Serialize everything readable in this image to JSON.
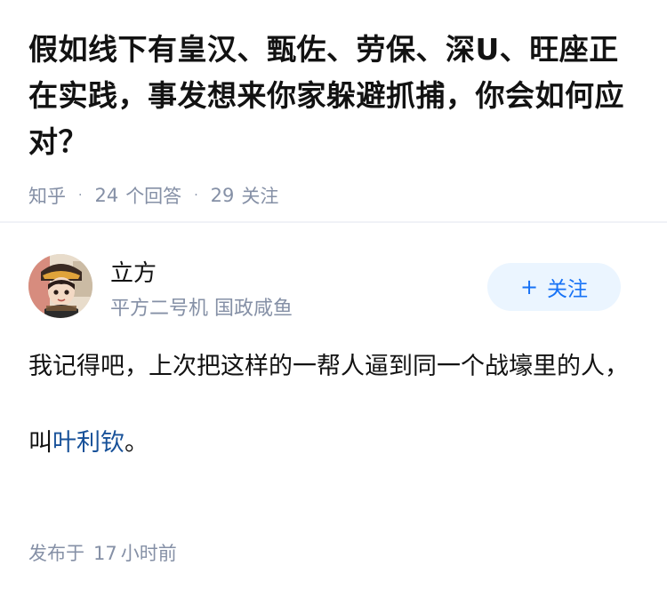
{
  "question": {
    "title": "假如线下有皇汉、甄佐、劳保、深U、旺座正在实践，事发想来你家躲避抓捕，你会如何应对？",
    "source": "知乎",
    "answers_count": "24",
    "answers_label": "个回答",
    "followers_count": "29",
    "followers_label": "关注"
  },
  "answer": {
    "author": {
      "name": "立方",
      "bio": "平方二号机 国政咸鱼",
      "follow_label": "关注",
      "follow_icon": "plus-icon"
    },
    "content": {
      "paragraph1": "我记得吧，上次把这样的一帮人逼到同一个战壕里的人，",
      "paragraph2_prefix": "叫",
      "paragraph2_link": "叶利钦",
      "paragraph2_suffix": "。"
    },
    "time": {
      "prefix": "发布于",
      "value": "17",
      "unit": "小时前"
    }
  },
  "colors": {
    "meta_gray": "#8590a6",
    "follow_blue": "#1772f6",
    "follow_bg": "#ebf5ff",
    "link_blue": "#175199"
  }
}
